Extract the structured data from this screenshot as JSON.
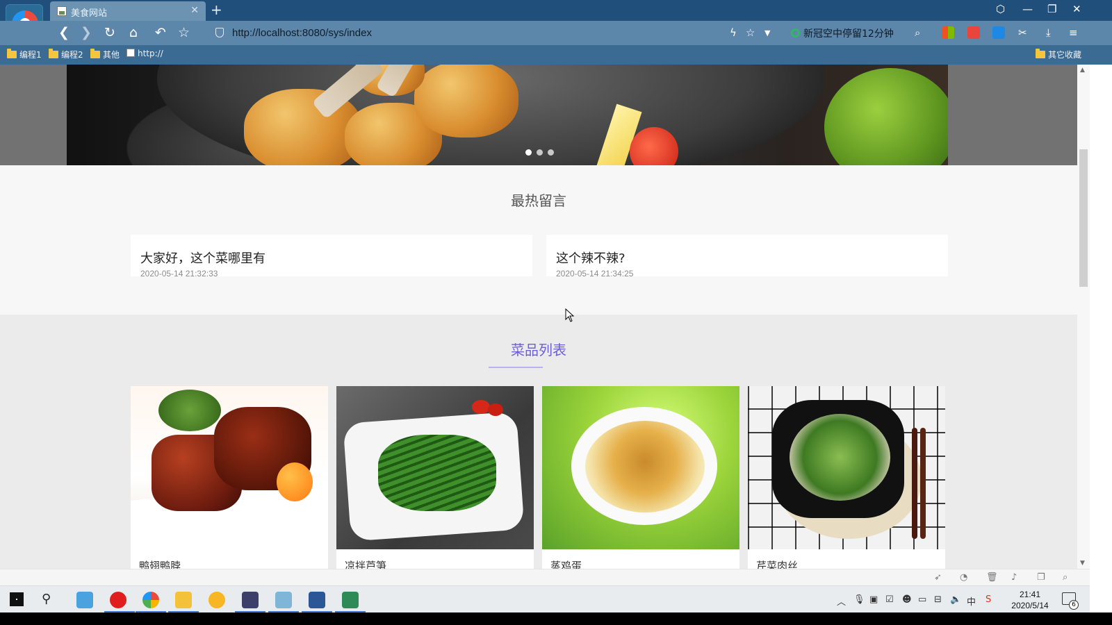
{
  "browser": {
    "tab_title": "美食网站",
    "tab_close": "✕",
    "new_tab": "+",
    "url": "http://localhost:8080/sys/index",
    "news_text": "新冠空中停留12分钟",
    "bookmarks": [
      "编程1",
      "编程2",
      "其他",
      "http://"
    ],
    "other_bookmarks": "其它收藏"
  },
  "hot_messages": {
    "title": "最热留言",
    "items": [
      {
        "text": "大家好，这个菜哪里有",
        "time": "2020-05-14 21:32:33"
      },
      {
        "text": "这个辣不辣?",
        "time": "2020-05-14 21:34:25"
      }
    ]
  },
  "carousel": {
    "slides": 3,
    "active": 1
  },
  "dishes": {
    "title": "菜品列表",
    "items": [
      {
        "name": "鸭翅鸭脖"
      },
      {
        "name": "凉拌芦笋"
      },
      {
        "name": "蒸鸡蛋"
      },
      {
        "name": "芹菜肉丝"
      }
    ]
  },
  "taskbar": {
    "time": "21:41",
    "date": "2020/5/14",
    "notification_count": "6"
  },
  "colors": {
    "titlebar": "#1f4f7a",
    "navbar": "#5c86aa",
    "bookmarks_bar": "#3b6b93",
    "dish_title": "#6b5fd3"
  }
}
